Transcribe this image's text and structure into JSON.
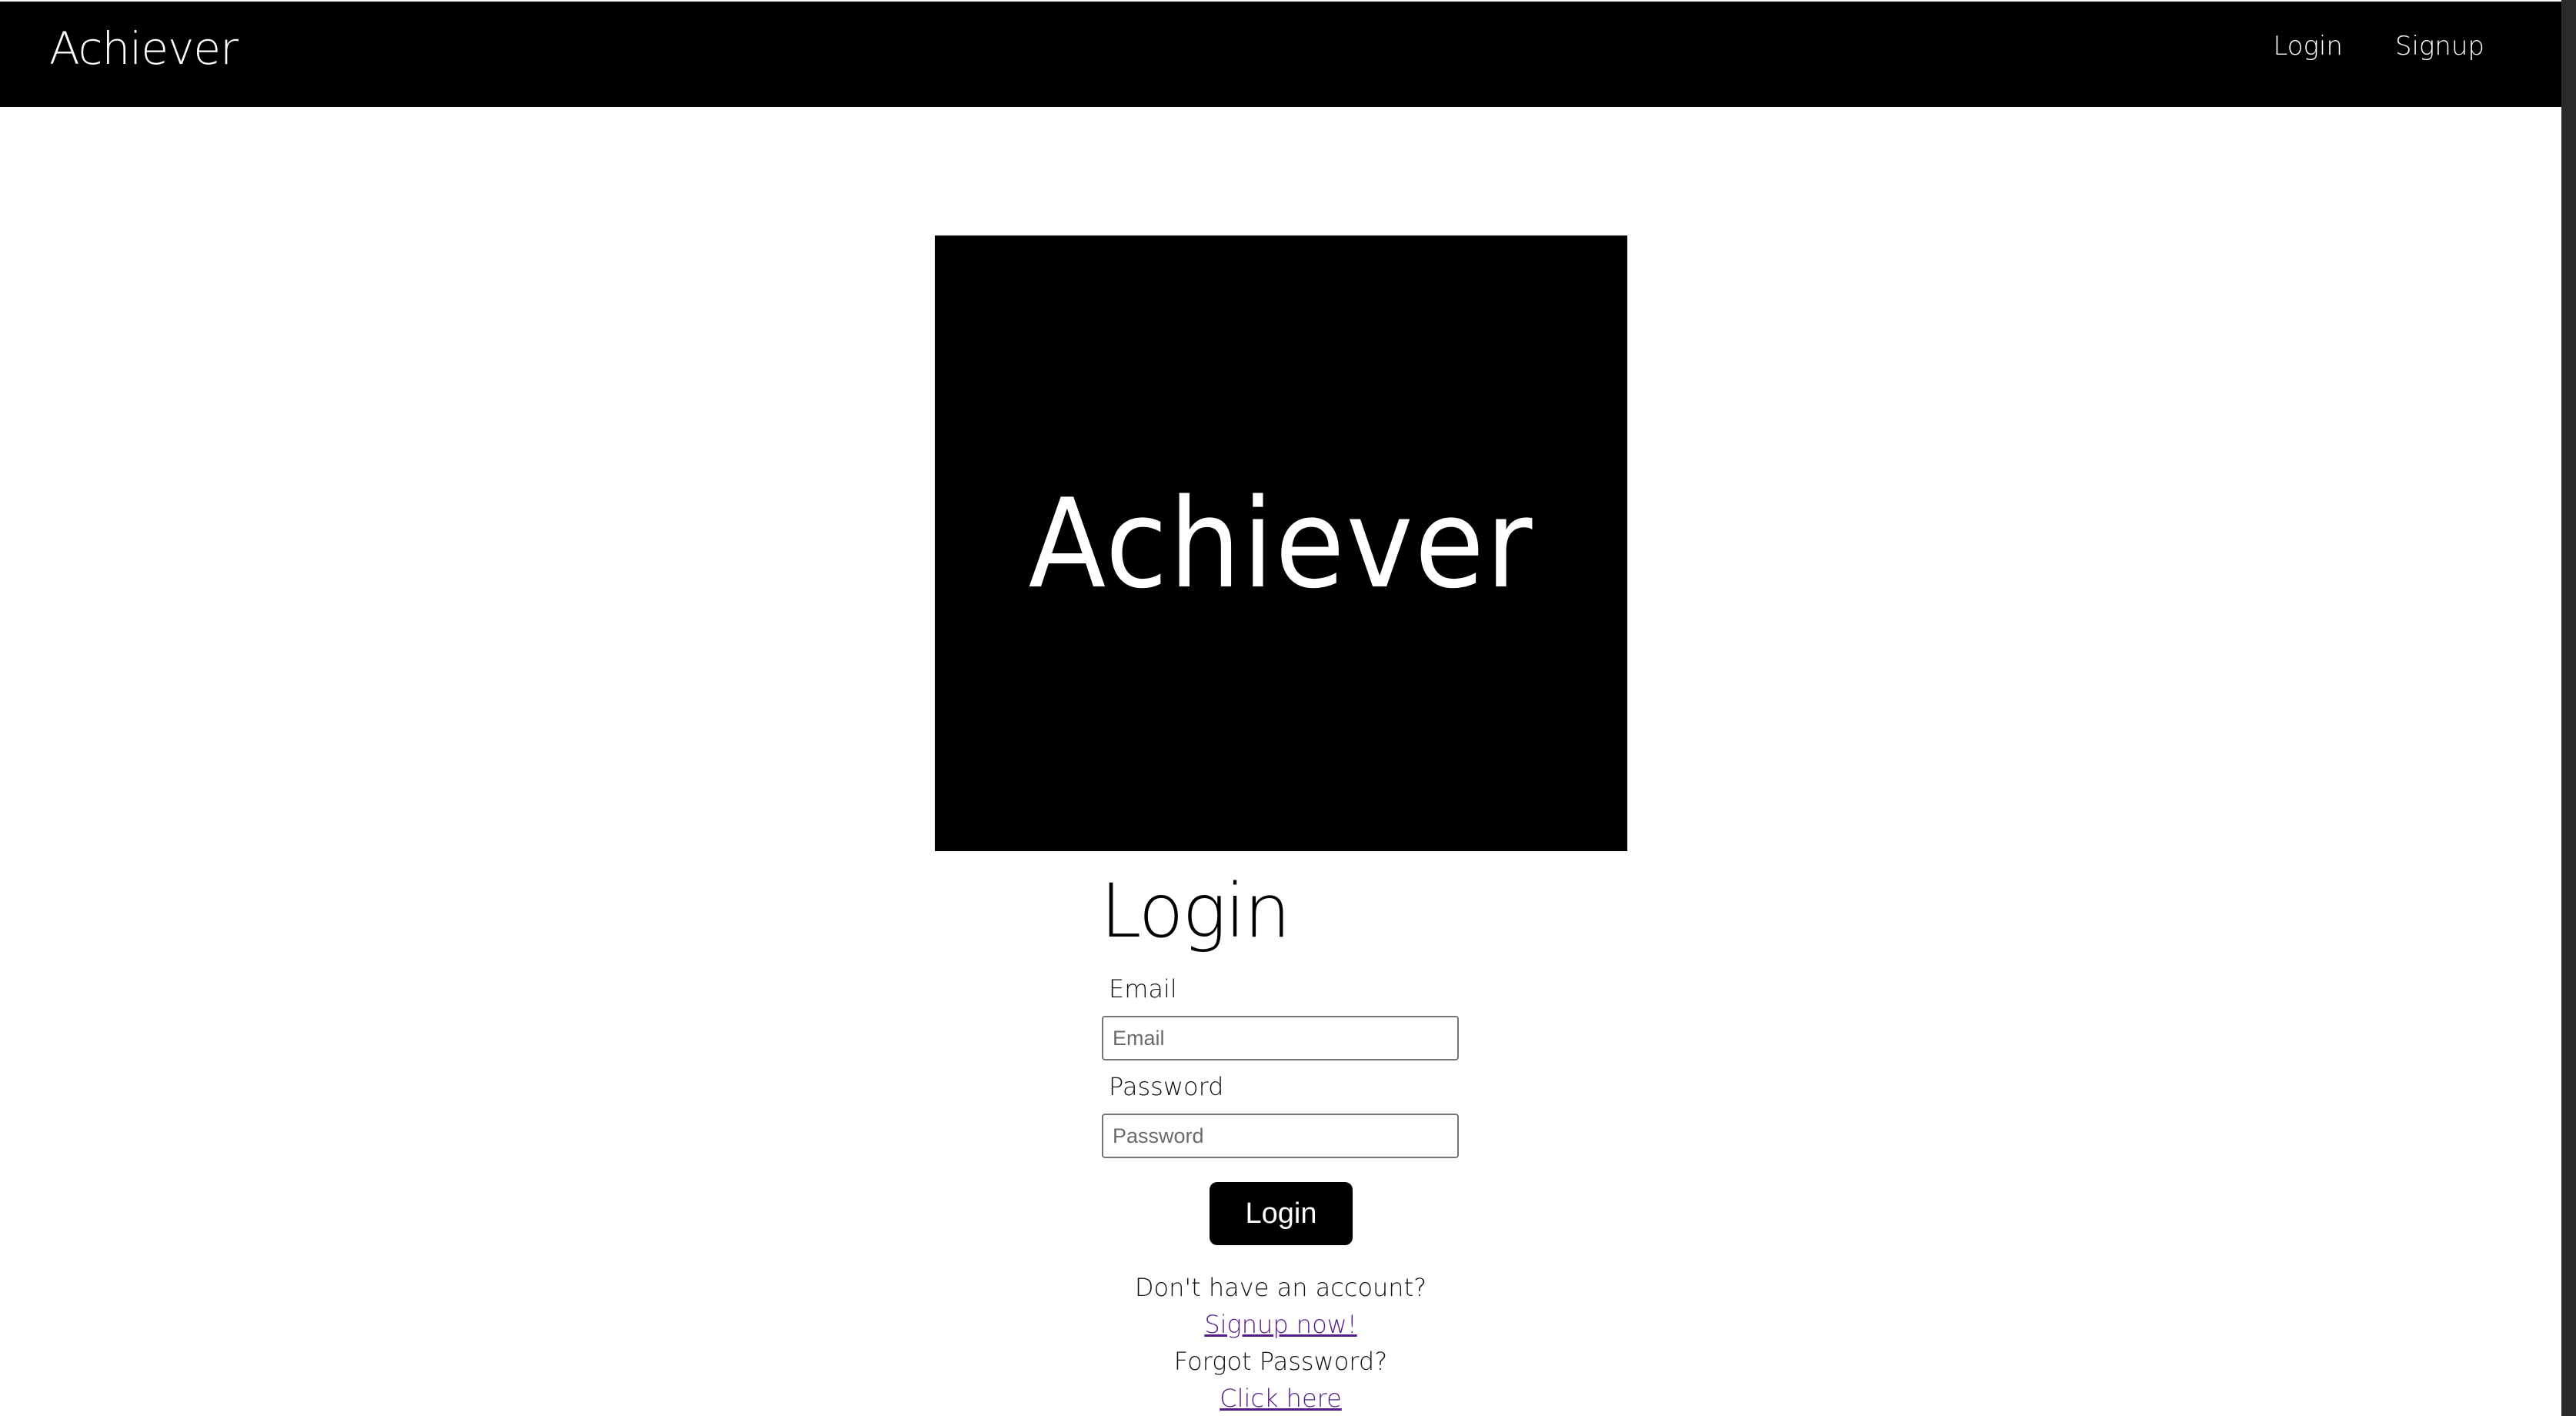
{
  "navbar": {
    "brand": "Achiever",
    "links": [
      {
        "label": "Login"
      },
      {
        "label": "Signup"
      }
    ]
  },
  "hero": {
    "title": "Achiever"
  },
  "login_form": {
    "heading": "Login",
    "email_label": "Email",
    "email_placeholder": "Email",
    "email_value": "",
    "password_label": "Password",
    "password_placeholder": "Password",
    "password_value": "",
    "submit_label": "Login"
  },
  "footer_links": {
    "no_account_text": "Don't have an account?",
    "signup_link": "Signup now!",
    "forgot_text": "Forgot Password?",
    "reset_link": "Click here"
  },
  "colors": {
    "navbar_bg": "#000000",
    "hero_bg": "#000000",
    "button_bg": "#000000",
    "visited_link": "#551a8b"
  }
}
